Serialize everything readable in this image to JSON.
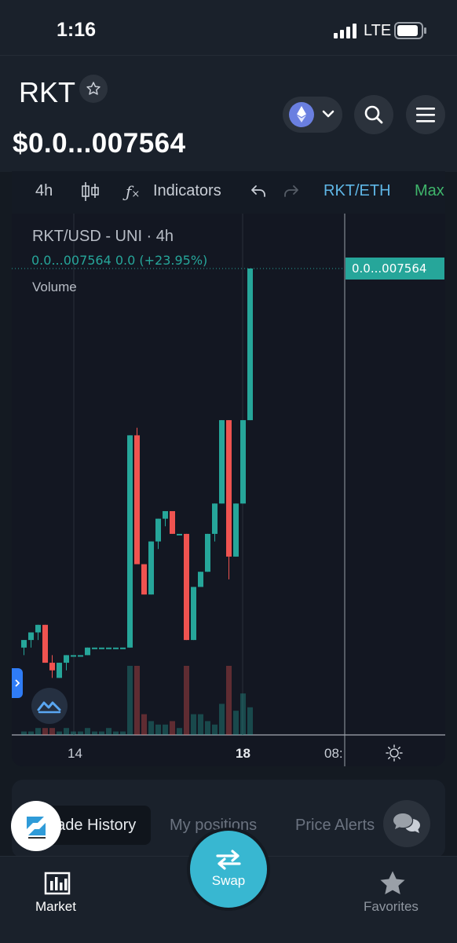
{
  "status": {
    "time": "1:16",
    "network": "LTE"
  },
  "header": {
    "title": "RKT",
    "price": "$0.0...007564"
  },
  "toolbar": {
    "interval": "4h",
    "indicators": "Indicators",
    "pair": "RKT/ETH",
    "max": "Max"
  },
  "chart": {
    "legend": "RKT/USD - UNI · 4h",
    "values": "0.0...007564  0.0 (+23.95%)",
    "volume_label": "Volume",
    "price_tag": "0.0...007564",
    "x_labels": [
      "14",
      "18",
      "08:"
    ]
  },
  "tabs": [
    "Trade History",
    "My positions",
    "Price Alerts"
  ],
  "nav": {
    "market": "Market",
    "swap": "Swap",
    "favorites": "Favorites"
  },
  "colors": {
    "up": "#26a69a",
    "down": "#ef5350",
    "accent": "#38b7d1"
  },
  "chart_data": {
    "type": "candlestick",
    "candles": [
      {
        "o": 2.6e-06,
        "h": 2.7e-06,
        "l": 2.5e-06,
        "c": 2.7e-06
      },
      {
        "o": 2.7e-06,
        "h": 2.8e-06,
        "l": 2.6e-06,
        "c": 2.8e-06
      },
      {
        "o": 2.8e-06,
        "h": 2.9e-06,
        "l": 2.7e-06,
        "c": 2.9e-06
      },
      {
        "o": 2.9e-06,
        "h": 2.9e-06,
        "l": 2.4e-06,
        "c": 2.4e-06
      },
      {
        "o": 2.4e-06,
        "h": 2.5e-06,
        "l": 2.2e-06,
        "c": 2.3e-06
      },
      {
        "o": 2.2e-06,
        "h": 2.4e-06,
        "l": 2.2e-06,
        "c": 2.4e-06
      },
      {
        "o": 2.4e-06,
        "h": 2.5e-06,
        "l": 2.3e-06,
        "c": 2.5e-06
      },
      {
        "o": 2.5e-06,
        "h": 2.5e-06,
        "l": 2.5e-06,
        "c": 2.5e-06
      },
      {
        "o": 2.5e-06,
        "h": 2.5e-06,
        "l": 2.5e-06,
        "c": 2.5e-06
      },
      {
        "o": 2.5e-06,
        "h": 2.6e-06,
        "l": 2.5e-06,
        "c": 2.6e-06
      },
      {
        "o": 2.6e-06,
        "h": 2.6e-06,
        "l": 2.6e-06,
        "c": 2.6e-06
      },
      {
        "o": 2.6e-06,
        "h": 2.6e-06,
        "l": 2.6e-06,
        "c": 2.6e-06
      },
      {
        "o": 2.6e-06,
        "h": 2.6e-06,
        "l": 2.6e-06,
        "c": 2.6e-06
      },
      {
        "o": 2.6e-06,
        "h": 2.6e-06,
        "l": 2.6e-06,
        "c": 2.6e-06
      },
      {
        "o": 2.6e-06,
        "h": 2.6e-06,
        "l": 2.6e-06,
        "c": 2.6e-06
      },
      {
        "o": 2.6e-06,
        "h": 5.4e-06,
        "l": 2.6e-06,
        "c": 5.4e-06
      },
      {
        "o": 5.4e-06,
        "h": 5.5e-06,
        "l": 3.7e-06,
        "c": 3.7e-06
      },
      {
        "o": 3.7e-06,
        "h": 3.7e-06,
        "l": 3.3e-06,
        "c": 3.3e-06
      },
      {
        "o": 3.3e-06,
        "h": 4e-06,
        "l": 3.3e-06,
        "c": 4e-06
      },
      {
        "o": 4e-06,
        "h": 4.3e-06,
        "l": 3.9e-06,
        "c": 4.3e-06
      },
      {
        "o": 4.3e-06,
        "h": 4.4e-06,
        "l": 4.2e-06,
        "c": 4.4e-06
      },
      {
        "o": 4.4e-06,
        "h": 4.4e-06,
        "l": 4.1e-06,
        "c": 4.1e-06
      },
      {
        "o": 4.1e-06,
        "h": 4.1e-06,
        "l": 4.1e-06,
        "c": 4.1e-06
      },
      {
        "o": 4.1e-06,
        "h": 4.1e-06,
        "l": 2.7e-06,
        "c": 2.7e-06
      },
      {
        "o": 2.7e-06,
        "h": 3.4e-06,
        "l": 2.7e-06,
        "c": 3.4e-06
      },
      {
        "o": 3.4e-06,
        "h": 3.6e-06,
        "l": 3.4e-06,
        "c": 3.6e-06
      },
      {
        "o": 3.6e-06,
        "h": 4.1e-06,
        "l": 3.6e-06,
        "c": 4.1e-06
      },
      {
        "o": 4.1e-06,
        "h": 4.5e-06,
        "l": 4e-06,
        "c": 4.5e-06
      },
      {
        "o": 4.5e-06,
        "h": 5.6e-06,
        "l": 4.5e-06,
        "c": 5.6e-06
      },
      {
        "o": 5.6e-06,
        "h": 5.6e-06,
        "l": 3.5e-06,
        "c": 3.8e-06
      },
      {
        "o": 3.8e-06,
        "h": 4.5e-06,
        "l": 3.8e-06,
        "c": 4.5e-06
      },
      {
        "o": 4.5e-06,
        "h": 5.6e-06,
        "l": 4.5e-06,
        "c": 5.6e-06
      },
      {
        "o": 5.6e-06,
        "h": 7.6e-06,
        "l": 5.6e-06,
        "c": 7.6e-06
      }
    ],
    "volume": [
      1,
      1,
      2,
      2,
      2,
      1,
      2,
      1,
      1,
      2,
      1,
      1,
      2,
      1,
      1,
      20,
      20,
      6,
      4,
      3,
      3,
      4,
      2,
      20,
      6,
      6,
      4,
      3,
      9,
      20,
      7,
      12,
      8
    ]
  }
}
